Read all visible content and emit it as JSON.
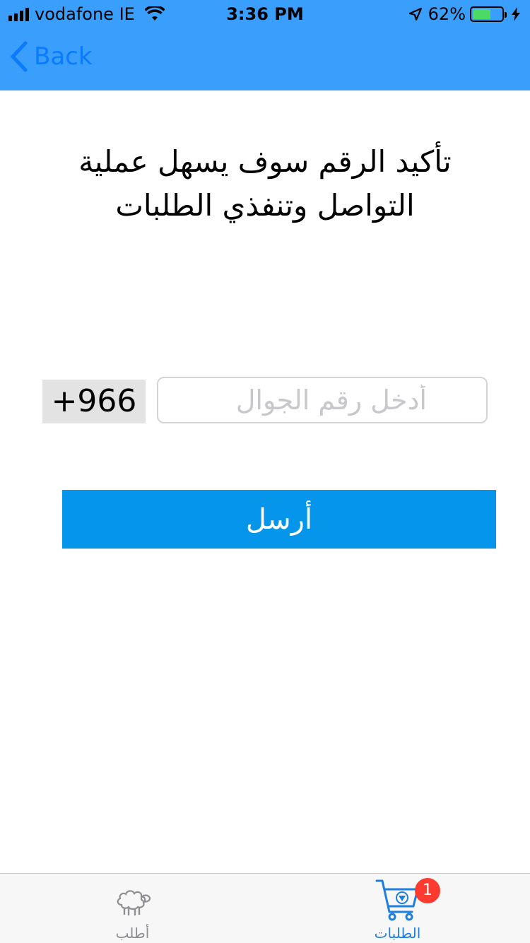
{
  "status_bar": {
    "carrier": "vodafone IE",
    "time": "3:36 PM",
    "battery_percent": "62%",
    "battery_level": 0.62,
    "icons": [
      "signal-icon",
      "wifi-icon",
      "location-arrow-icon",
      "battery-icon",
      "charging-bolt-icon"
    ]
  },
  "nav": {
    "back_label": "Back"
  },
  "headline": "تأكيد الرقم سوف يسهل عملية التواصل وتنفذي الطلبات",
  "phone": {
    "country_code": "+966",
    "value": "",
    "placeholder": "أدخل رقم الجوال"
  },
  "send_button": {
    "label": "أرسل"
  },
  "tab_bar": {
    "tabs": [
      {
        "label": "أطلب",
        "icon": "sheep-icon",
        "selected": false
      },
      {
        "label": "الطلبات",
        "icon": "cart-icon",
        "selected": true,
        "badge": "1"
      }
    ]
  },
  "colors": {
    "header_bg": "#3a9ffc",
    "back_text": "#0a7aff",
    "button_bg": "#0596ec",
    "badge_bg": "#ff3b30",
    "tab_selected": "#1f7fe0",
    "tab_unselected": "#8e8e93"
  }
}
